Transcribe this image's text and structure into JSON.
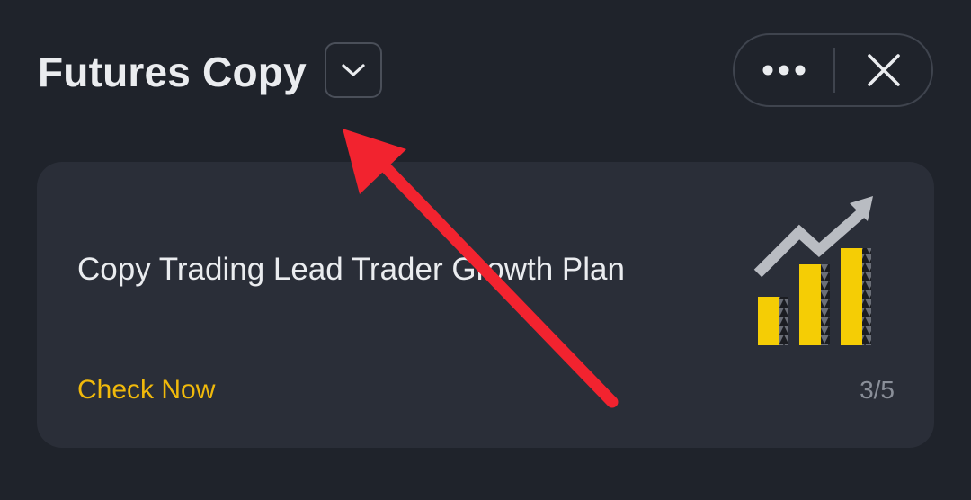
{
  "header": {
    "title": "Futures Copy",
    "dropdown_icon": "chevron-down-icon",
    "more_icon": "more-horizontal-icon",
    "close_icon": "close-icon"
  },
  "card": {
    "title": "Copy Trading Lead Trader Growth Plan",
    "cta": "Check Now",
    "counter": "3/5",
    "illustration_icon": "growth-chart-icon"
  },
  "colors": {
    "background": "#1f232b",
    "card": "#2a2e38",
    "accent": "#f0b90b",
    "text": "#eaecef",
    "muted": "#8a8f99",
    "annotation_arrow": "#f2232f"
  }
}
